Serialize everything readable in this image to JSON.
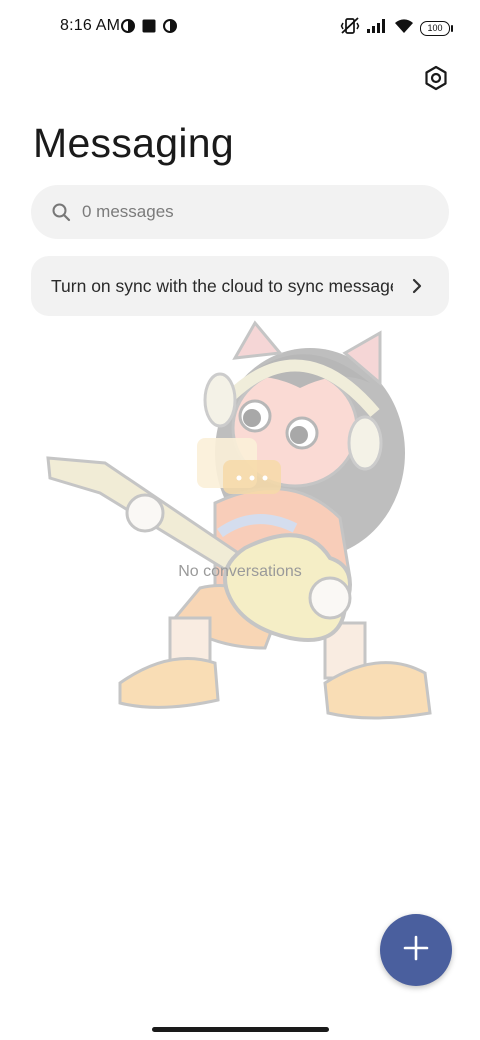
{
  "status_bar": {
    "time": "8:16 AM",
    "battery": "100",
    "left_icons": [
      "data-saver-icon",
      "stop-square-icon",
      "data-saver-icon"
    ],
    "right_icons": [
      "vibrate-off-icon",
      "cellular-signal-icon",
      "wifi-icon",
      "battery-icon"
    ]
  },
  "header": {
    "title": "Messaging",
    "settings_icon": "settings-hex-icon"
  },
  "search": {
    "placeholder": "0 messages",
    "icon": "search-icon"
  },
  "sync_banner": {
    "text": "Turn on sync with the cloud to sync messages",
    "icon": "chevron-right-icon"
  },
  "empty_state": {
    "text": "No conversations",
    "icon": "chat-bubbles-icon"
  },
  "fab": {
    "icon": "plus-icon",
    "color": "#4a5f9e"
  },
  "colors": {
    "accent": "#4a5f9e",
    "surface": "#f2f2f2",
    "background": "#ffffff"
  }
}
